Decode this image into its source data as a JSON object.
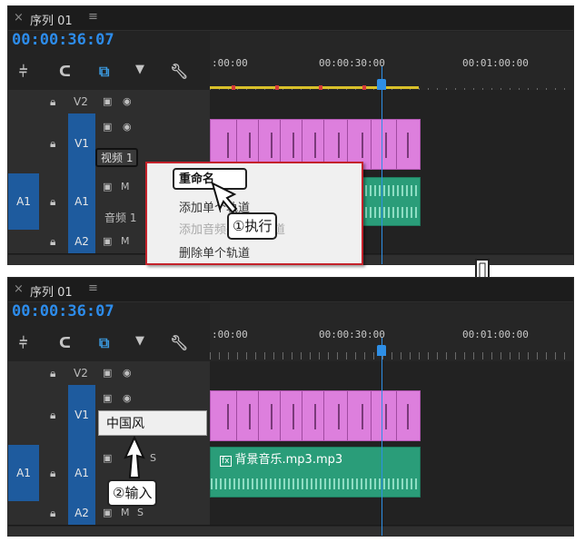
{
  "panel1": {
    "tab_close": "×",
    "tab_title": "序列 01",
    "tab_menu": "≡",
    "timecode": "00:00:36:07",
    "ruler_labels": [
      ":00:00",
      "00:00:30:00",
      "00:01:00:00"
    ],
    "tracks": {
      "v2": "V2",
      "v1_target": "V1",
      "v1_name": "视频 1",
      "a1_source": "A1",
      "a1_target": "A1",
      "a1_name": "音频 1",
      "a2": "A2",
      "mute": "M"
    },
    "context_menu": {
      "rename": "重命名",
      "add_track": "添加单个轨道",
      "add_audio_sub": "添加音频子混合轨道",
      "delete_track": "删除单个轨道"
    },
    "callout": "①执行"
  },
  "panel2": {
    "tab_close": "×",
    "tab_title": "序列 01",
    "tab_menu": "≡",
    "timecode": "00:00:36:07",
    "ruler_labels": [
      ":00:00",
      "00:00:30:00",
      "00:01:00:00"
    ],
    "tracks": {
      "v2": "V2",
      "v1_target": "V1",
      "v1_name_edit": "中国风",
      "a1_source": "A1",
      "a1_target": "A1",
      "a2": "A2",
      "mute": "M",
      "solo": "S"
    },
    "audio_clip_name": "背景音乐.mp3.mp3",
    "fx_badge": "fx",
    "callout": "②输入"
  },
  "colors": {
    "timecode": "#2d8ceb",
    "video_clip": "#dd7fdd",
    "audio_clip": "#2a9d79",
    "playhead": "#2e8fe6",
    "highlight_border": "#c4222b"
  }
}
